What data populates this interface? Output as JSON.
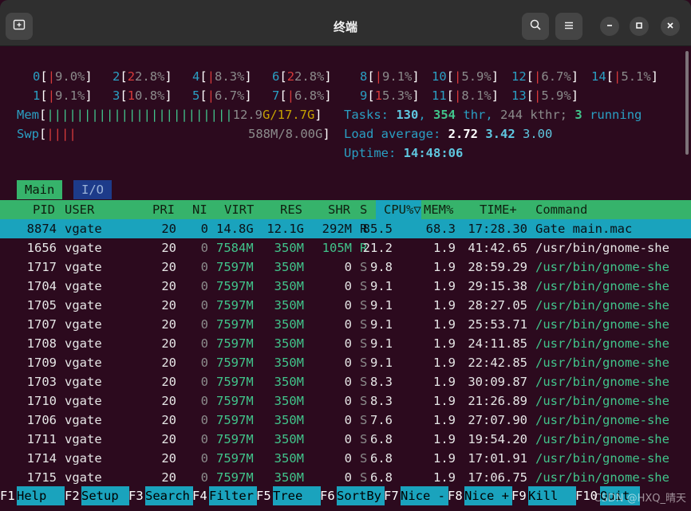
{
  "window": {
    "title": "终端"
  },
  "cpus": {
    "row1": [
      {
        "id": "0",
        "bar": "|",
        "pct": "9.0%"
      },
      {
        "id": "2",
        "bar": "2",
        "pct": "2.8%"
      },
      {
        "id": "4",
        "bar": "|",
        "pct": "8.3%"
      },
      {
        "id": "6",
        "bar": "2",
        "pct": "2.8%"
      },
      {
        "id": "8",
        "bar": "|",
        "pct": "9.1%"
      },
      {
        "id": "10",
        "bar": "|",
        "pct": "5.9%"
      },
      {
        "id": "12",
        "bar": "|",
        "pct": "6.7%"
      },
      {
        "id": "14",
        "bar": "|",
        "pct": "5.1%"
      }
    ],
    "row2": [
      {
        "id": "1",
        "bar": "|",
        "pct": "9.1%"
      },
      {
        "id": "3",
        "bar": "1",
        "pct": "0.8%"
      },
      {
        "id": "5",
        "bar": "|",
        "pct": "6.7%"
      },
      {
        "id": "7",
        "bar": "|",
        "pct": "6.8%"
      },
      {
        "id": "9",
        "bar": "1",
        "pct": "5.3%"
      },
      {
        "id": "11",
        "bar": "|",
        "pct": "8.1%"
      },
      {
        "id": "13",
        "bar": "|",
        "pct": "5.9%"
      }
    ]
  },
  "mem": {
    "label": "Mem",
    "bars": "|||||||||||||||||||||||||",
    "used": "12.9",
    "sep": "G/17.7G",
    "swp_label": "Swp",
    "swp_bars": "||||",
    "swp_value": "588M/8.00G"
  },
  "tasks": {
    "label": "Tasks:",
    "count": "130",
    "thr": "354",
    "thr_label": "thr,",
    "kthr": "244 kthr;",
    "running": "3",
    "running_label": "running",
    "load_label": "Load average:",
    "load1": "2.72",
    "load5": "3.42",
    "load15": "3.00",
    "uptime_label": "Uptime:",
    "uptime": "14:48:06"
  },
  "tabs": [
    {
      "label": "Main"
    },
    {
      "label": "I/O"
    }
  ],
  "columns": {
    "pid": "PID",
    "user": "USER",
    "pri": "PRI",
    "ni": "NI",
    "virt": "VIRT",
    "res": "RES",
    "shr": "SHR",
    "s": "S",
    "cpu": "CPU%▽",
    "mem": "MEM%",
    "time": "TIME+",
    "cmd": "Command"
  },
  "processes": [
    {
      "pid": "8874",
      "user": "vgate",
      "pri": "20",
      "ni": "0",
      "virt": "14.8G",
      "res": "12.1G",
      "shr": "292M",
      "s": "R",
      "cpu": "85.5",
      "mem": "68.3",
      "time": "17:28.30",
      "cmd": "Gate main.mac"
    },
    {
      "pid": "1656",
      "user": "vgate",
      "pri": "20",
      "ni": "0",
      "virt": "7584M",
      "res": "350M",
      "shr": "105M",
      "s": "R",
      "cpu": "21.2",
      "mem": "1.9",
      "time": "41:42.65",
      "cmd": "/usr/bin/gnome-she"
    },
    {
      "pid": "1717",
      "user": "vgate",
      "pri": "20",
      "ni": "0",
      "virt": "7597M",
      "res": "350M",
      "shr": "0",
      "s": "S",
      "cpu": "9.8",
      "mem": "1.9",
      "time": "28:59.29",
      "cmd": "/usr/bin/gnome-she"
    },
    {
      "pid": "1704",
      "user": "vgate",
      "pri": "20",
      "ni": "0",
      "virt": "7597M",
      "res": "350M",
      "shr": "0",
      "s": "S",
      "cpu": "9.1",
      "mem": "1.9",
      "time": "29:15.38",
      "cmd": "/usr/bin/gnome-she"
    },
    {
      "pid": "1705",
      "user": "vgate",
      "pri": "20",
      "ni": "0",
      "virt": "7597M",
      "res": "350M",
      "shr": "0",
      "s": "S",
      "cpu": "9.1",
      "mem": "1.9",
      "time": "28:27.05",
      "cmd": "/usr/bin/gnome-she"
    },
    {
      "pid": "1707",
      "user": "vgate",
      "pri": "20",
      "ni": "0",
      "virt": "7597M",
      "res": "350M",
      "shr": "0",
      "s": "S",
      "cpu": "9.1",
      "mem": "1.9",
      "time": "25:53.71",
      "cmd": "/usr/bin/gnome-she"
    },
    {
      "pid": "1708",
      "user": "vgate",
      "pri": "20",
      "ni": "0",
      "virt": "7597M",
      "res": "350M",
      "shr": "0",
      "s": "S",
      "cpu": "9.1",
      "mem": "1.9",
      "time": "24:11.85",
      "cmd": "/usr/bin/gnome-she"
    },
    {
      "pid": "1709",
      "user": "vgate",
      "pri": "20",
      "ni": "0",
      "virt": "7597M",
      "res": "350M",
      "shr": "0",
      "s": "S",
      "cpu": "9.1",
      "mem": "1.9",
      "time": "22:42.85",
      "cmd": "/usr/bin/gnome-she"
    },
    {
      "pid": "1703",
      "user": "vgate",
      "pri": "20",
      "ni": "0",
      "virt": "7597M",
      "res": "350M",
      "shr": "0",
      "s": "S",
      "cpu": "8.3",
      "mem": "1.9",
      "time": "30:09.87",
      "cmd": "/usr/bin/gnome-she"
    },
    {
      "pid": "1710",
      "user": "vgate",
      "pri": "20",
      "ni": "0",
      "virt": "7597M",
      "res": "350M",
      "shr": "0",
      "s": "S",
      "cpu": "8.3",
      "mem": "1.9",
      "time": "21:26.89",
      "cmd": "/usr/bin/gnome-she"
    },
    {
      "pid": "1706",
      "user": "vgate",
      "pri": "20",
      "ni": "0",
      "virt": "7597M",
      "res": "350M",
      "shr": "0",
      "s": "S",
      "cpu": "7.6",
      "mem": "1.9",
      "time": "27:07.90",
      "cmd": "/usr/bin/gnome-she"
    },
    {
      "pid": "1711",
      "user": "vgate",
      "pri": "20",
      "ni": "0",
      "virt": "7597M",
      "res": "350M",
      "shr": "0",
      "s": "S",
      "cpu": "6.8",
      "mem": "1.9",
      "time": "19:54.20",
      "cmd": "/usr/bin/gnome-she"
    },
    {
      "pid": "1714",
      "user": "vgate",
      "pri": "20",
      "ni": "0",
      "virt": "7597M",
      "res": "350M",
      "shr": "0",
      "s": "S",
      "cpu": "6.8",
      "mem": "1.9",
      "time": "17:01.91",
      "cmd": "/usr/bin/gnome-she"
    },
    {
      "pid": "1715",
      "user": "vgate",
      "pri": "20",
      "ni": "0",
      "virt": "7597M",
      "res": "350M",
      "shr": "0",
      "s": "S",
      "cpu": "6.8",
      "mem": "1.9",
      "time": "17:06.75",
      "cmd": "/usr/bin/gnome-she"
    }
  ],
  "fkeys": [
    {
      "key": "F1",
      "label": "Help  "
    },
    {
      "key": "F2",
      "label": "Setup "
    },
    {
      "key": "F3",
      "label": "Search"
    },
    {
      "key": "F4",
      "label": "Filter"
    },
    {
      "key": "F5",
      "label": "Tree  "
    },
    {
      "key": "F6",
      "label": "SortBy"
    },
    {
      "key": "F7",
      "label": "Nice -"
    },
    {
      "key": "F8",
      "label": "Nice +"
    },
    {
      "key": "F9",
      "label": "Kill  "
    },
    {
      "key": "F10",
      "label": "Quit"
    }
  ],
  "watermark": "CSDN @HXQ_晴天",
  "icons": {
    "new_tab": "new-tab-icon",
    "search": "search-icon",
    "menu": "hamburger-menu-icon",
    "minimize": "minimize-icon",
    "maximize": "maximize-icon",
    "close": "close-icon"
  }
}
